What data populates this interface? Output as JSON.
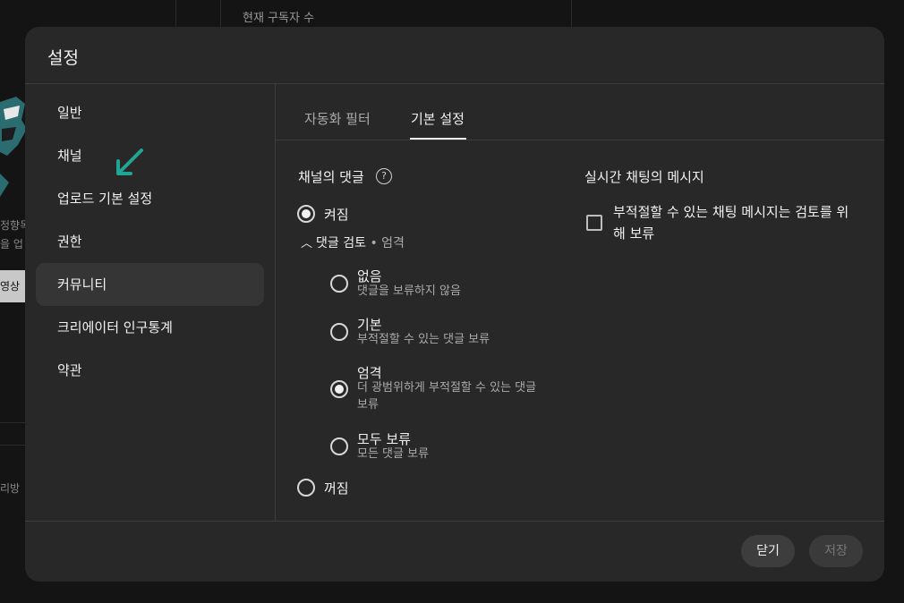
{
  "background": {
    "header": "현재 구독자 수",
    "frag1": "정향목",
    "frag2": "을 업",
    "button": "영상",
    "frag3": "리방"
  },
  "dialog": {
    "title": "설정",
    "sidebar": {
      "items": [
        {
          "label": "일반"
        },
        {
          "label": "채널"
        },
        {
          "label": "업로드 기본 설정"
        },
        {
          "label": "권한"
        },
        {
          "label": "커뮤니티"
        },
        {
          "label": "크리에이터 인구통계"
        },
        {
          "label": "약관"
        }
      ],
      "active_index": 4
    },
    "tabs": [
      {
        "label": "자동화 필터"
      },
      {
        "label": "기본 설정"
      }
    ],
    "active_tab": 1,
    "comments": {
      "title": "채널의 댓글",
      "help_symbol": "?",
      "on_label": "켜짐",
      "review_label": "댓글 검토",
      "review_separator": "•",
      "review_level": "엄격",
      "options": [
        {
          "label": "없음",
          "desc": "댓글을 보류하지 않음"
        },
        {
          "label": "기본",
          "desc": "부적절할 수 있는 댓글 보류"
        },
        {
          "label": "엄격",
          "desc": "더 광범위하게 부적절할 수 있는 댓글 보류"
        },
        {
          "label": "모두 보류",
          "desc": "모든 댓글 보류"
        }
      ],
      "selected_option": "엄격",
      "off_label": "꺼짐",
      "state": "켜짐"
    },
    "live_chat": {
      "title": "실시간 채팅의 메시지",
      "checkbox_label": "부적절할 수 있는 채팅 메시지는 검토를 위해 보류",
      "checked": false
    },
    "footer": {
      "close_label": "닫기",
      "save_label": "저장"
    }
  },
  "colors": {
    "accent_arrow": "#1fa594",
    "dialog_bg": "#282828",
    "active_item_bg": "#353535"
  }
}
